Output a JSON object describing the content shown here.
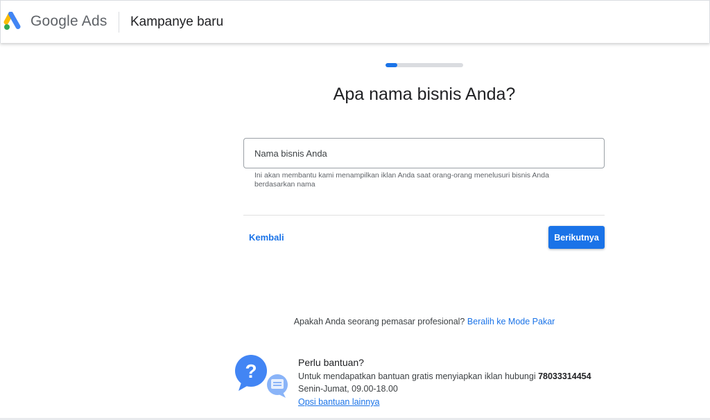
{
  "header": {
    "brand": "Google Ads",
    "title": "Kampanye baru"
  },
  "progress": {
    "fraction": 0.15,
    "color": "#1a73e8"
  },
  "main": {
    "question": "Apa nama bisnis Anda?",
    "input": {
      "placeholder": "Nama bisnis Anda",
      "value": ""
    },
    "helper": "Ini akan membantu kami menampilkan iklan Anda saat orang-orang menelusuri bisnis Anda berdasarkan nama",
    "back_label": "Kembali",
    "next_label": "Berikutnya"
  },
  "expert": {
    "prompt": "Apakah Anda seorang pemasar profesional? ",
    "link": "Beralih ke Mode Pakar"
  },
  "help": {
    "title": "Perlu bantuan?",
    "desc": "Untuk mendapatkan bantuan gratis menyiapkan iklan hubungi ",
    "phone": "78033314454",
    "hours": "Senin-Jumat, 09.00-18.00",
    "link": "Opsi bantuan lainnya"
  },
  "colors": {
    "accent": "#1a73e8",
    "logo_yellow": "#fbbc04",
    "logo_blue": "#4285f4",
    "logo_green": "#34a853"
  },
  "icons": {
    "logo": "google-ads-logo",
    "help": "question-chat-icon"
  }
}
